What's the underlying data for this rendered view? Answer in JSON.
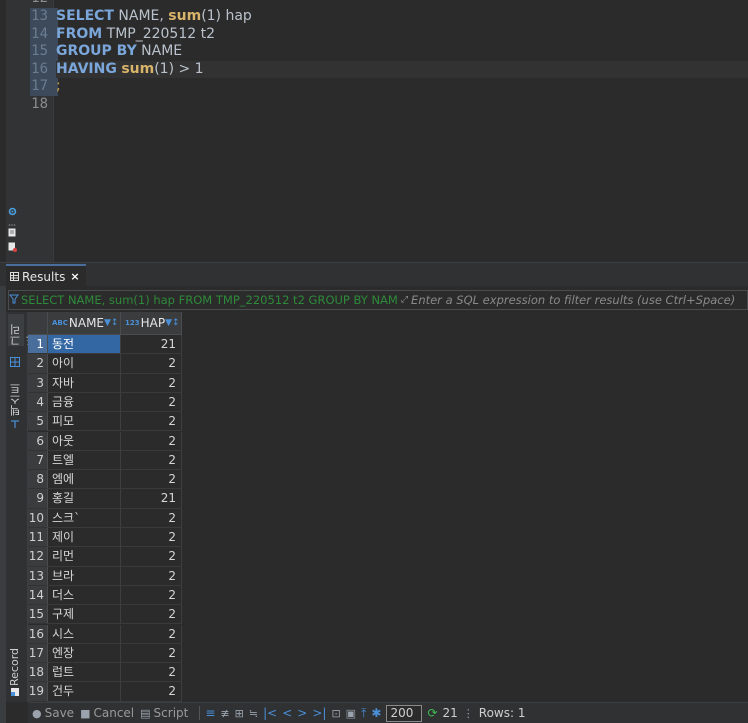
{
  "editor": {
    "partial_line_number": "12",
    "lines": [
      {
        "n": "13",
        "kind": "sql",
        "parts": [
          [
            "kw",
            "SELECT"
          ],
          [
            "tx",
            " NAME, "
          ],
          [
            "fn",
            "sum"
          ],
          [
            "tx",
            "(1) hap"
          ]
        ]
      },
      {
        "n": "14",
        "kind": "sql",
        "parts": [
          [
            "kw",
            "FROM"
          ],
          [
            "tx",
            " TMP_220512 t2"
          ]
        ]
      },
      {
        "n": "15",
        "kind": "sql",
        "parts": [
          [
            "kw",
            "GROUP BY"
          ],
          [
            "tx",
            " NAME"
          ]
        ]
      },
      {
        "n": "16",
        "kind": "sql",
        "parts": [
          [
            "kw",
            "HAVING"
          ],
          [
            "tx",
            " "
          ],
          [
            "fn",
            "sum"
          ],
          [
            "tx",
            "(1) > 1"
          ]
        ]
      },
      {
        "n": "17",
        "kind": "sql",
        "parts": [
          [
            "semi",
            ";"
          ]
        ]
      },
      {
        "n": "18",
        "kind": "plain",
        "parts": []
      }
    ]
  },
  "results": {
    "tab_label": "Results",
    "tab_close": "×",
    "filter_query": "SELECT NAME, sum(1) hap FROM TMP_220512 t2 GROUP BY NAM",
    "filter_placeholder": "Enter a SQL expression to filter results (use Ctrl+Space)",
    "side_tabs": {
      "grid": "그리드",
      "text": "텍스트",
      "record": "Record"
    },
    "columns": [
      {
        "name": "NAME",
        "type_icon": "ABC"
      },
      {
        "name": "HAP",
        "type_icon": "123"
      }
    ],
    "rows": [
      {
        "n": "1",
        "name": "동전",
        "hap": "21"
      },
      {
        "n": "2",
        "name": "아이",
        "hap": "2"
      },
      {
        "n": "3",
        "name": "자바",
        "hap": "2"
      },
      {
        "n": "4",
        "name": "금융",
        "hap": "2"
      },
      {
        "n": "5",
        "name": "피모",
        "hap": "2"
      },
      {
        "n": "6",
        "name": "아웃",
        "hap": "2"
      },
      {
        "n": "7",
        "name": "트엘",
        "hap": "2"
      },
      {
        "n": "8",
        "name": "엠에",
        "hap": "2"
      },
      {
        "n": "9",
        "name": "홍길",
        "hap": "21"
      },
      {
        "n": "10",
        "name": "스크`",
        "hap": "2"
      },
      {
        "n": "11",
        "name": "제이",
        "hap": "2"
      },
      {
        "n": "12",
        "name": "리먼",
        "hap": "2"
      },
      {
        "n": "13",
        "name": "브라",
        "hap": "2"
      },
      {
        "n": "14",
        "name": "더스",
        "hap": "2"
      },
      {
        "n": "15",
        "name": "구제",
        "hap": "2"
      },
      {
        "n": "16",
        "name": "시스",
        "hap": "2"
      },
      {
        "n": "17",
        "name": "엔장",
        "hap": "2"
      },
      {
        "n": "18",
        "name": "럽트",
        "hap": "2"
      },
      {
        "n": "19",
        "name": "건두",
        "hap": "2"
      }
    ],
    "selected_row": "1"
  },
  "toolbar": {
    "save_label": "Save",
    "cancel_label": "Cancel",
    "script_label": "Script",
    "fetch_size": "200",
    "row_count": "21",
    "rows_label": "Rows: 1"
  },
  "colors": {
    "accent": "#4a90d9",
    "selection": "#3367a3",
    "keyword": "#7aa6da",
    "function": "#d8b36a",
    "filter_query": "#2e8a3a"
  }
}
